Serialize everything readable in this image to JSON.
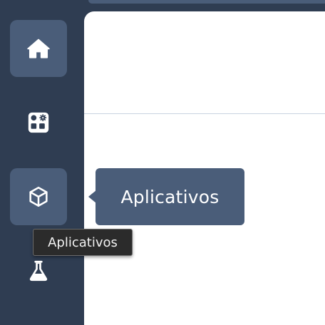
{
  "sidebar": {
    "items": [
      {
        "id": "home",
        "icon": "home-icon",
        "active": true
      },
      {
        "id": "widgets",
        "icon": "widgets-gear-icon",
        "active": false
      },
      {
        "id": "apps",
        "icon": "cube-icon",
        "active": true
      },
      {
        "id": "lab",
        "icon": "flask-icon",
        "active": false
      }
    ]
  },
  "popover": {
    "label": "Aplicativos"
  },
  "tooltip": {
    "label": "Aplicativos"
  },
  "colors": {
    "sidebar_bg": "#2f3d52",
    "active_item": "#4a5d79",
    "panel_bg": "#ffffff",
    "icon": "#ffffff"
  }
}
